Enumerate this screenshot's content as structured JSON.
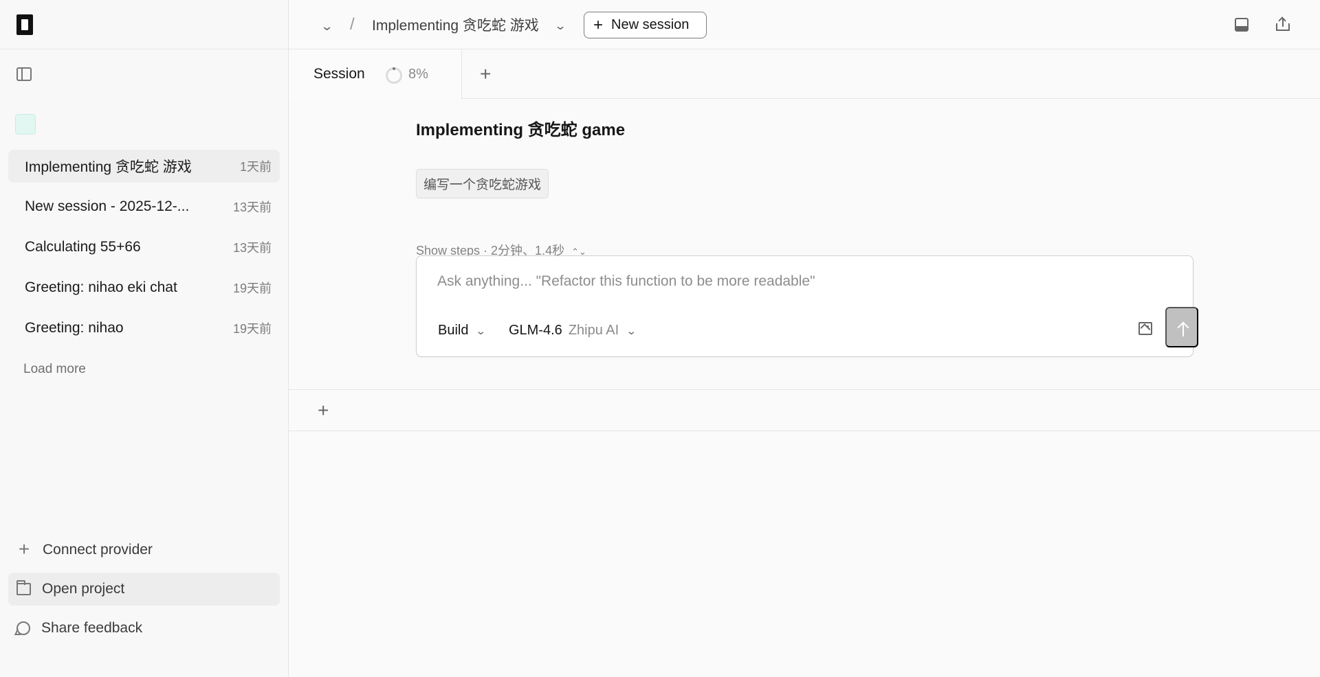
{
  "breadcrumb": {
    "separator": "/",
    "current_title": "Implementing 贪吃蛇 游戏"
  },
  "header": {
    "new_session_label": "New session",
    "new_session_icon": "plus-icon"
  },
  "sidebar": {
    "sessions": [
      {
        "title": "Implementing 贪吃蛇 游戏",
        "time": "1天前",
        "active": true
      },
      {
        "title": "New session - 2025-12-...",
        "time": "13天前",
        "active": false
      },
      {
        "title": "Calculating 55+66",
        "time": "13天前",
        "active": false
      },
      {
        "title": "Greeting: nihao eki chat",
        "time": "19天前",
        "active": false
      },
      {
        "title": "Greeting: nihao",
        "time": "19天前",
        "active": false
      }
    ],
    "load_more": "Load more",
    "actions": [
      {
        "label": "Connect provider",
        "icon": "plus-icon"
      },
      {
        "label": "Open project",
        "icon": "folder-icon"
      },
      {
        "label": "Share feedback",
        "icon": "chat-bubble-icon"
      }
    ]
  },
  "tabs": {
    "active_label": "Session",
    "progress_text": "8%",
    "progress_value": 0.08
  },
  "content": {
    "title": "Implementing 贪吃蛇 game",
    "user_message": "编写一个贪吃蛇游戏",
    "steps_label": "Show steps · 2分钟、1.4秒"
  },
  "composer": {
    "placeholder": "Ask anything... \"Refactor this function to be more readable\"",
    "agent": "Build",
    "model": "GLM-4.6",
    "provider": "Zhipu AI"
  },
  "colors": {
    "sidebar_background": "#f8f8f8",
    "active_session_background": "#eeeeee",
    "project_avatar_background": "#e2f7f1",
    "send_button": "#c0c0c0"
  }
}
